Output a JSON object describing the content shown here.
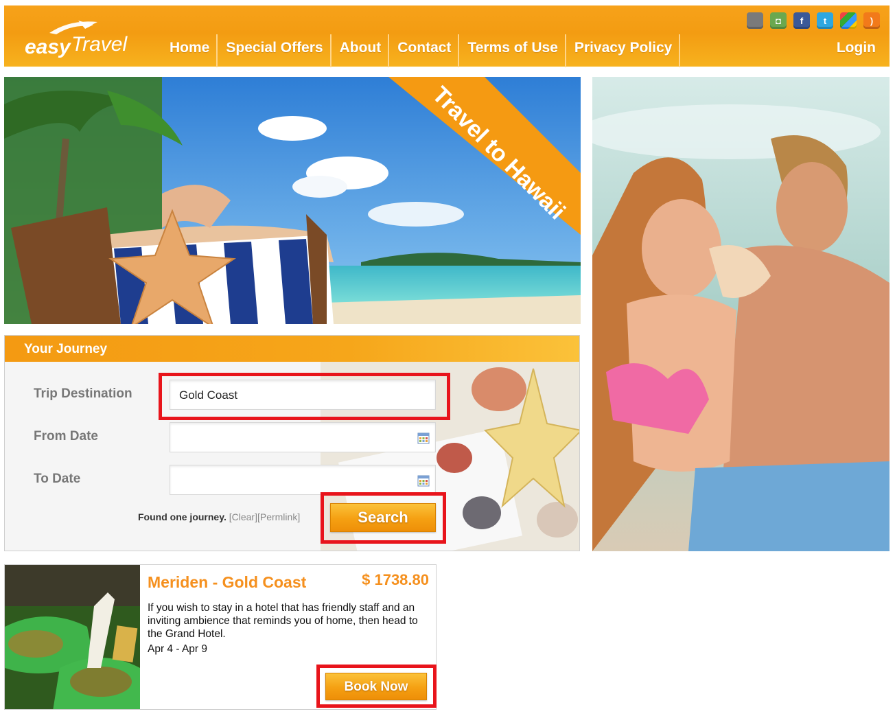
{
  "header": {
    "logo_text": "easyTravel",
    "nav": [
      "Home",
      "Special Offers",
      "About",
      "Contact",
      "Terms of Use",
      "Privacy Policy"
    ],
    "login": "Login",
    "social_icons": [
      "apple-icon",
      "android-icon",
      "facebook-icon",
      "twitter-icon",
      "windows-icon",
      "rss-icon"
    ]
  },
  "hero": {
    "ribbon_text": "Travel to Hawaii"
  },
  "journey": {
    "title": "Your Journey",
    "destination_label": "Trip Destination",
    "destination_value": "Gold Coast",
    "from_label": "From Date",
    "from_value": "",
    "to_label": "To Date",
    "to_value": "",
    "status_text": "Found one journey.",
    "clear_link": "[Clear]",
    "permlink": "[Permlink]",
    "search_button": "Search"
  },
  "result": {
    "title": "Meriden - Gold Coast",
    "price": "$ 1738.80",
    "description": "If you wish to stay in a hotel that has friendly staff and an inviting ambience that reminds you of home, then head to the Grand Hotel.",
    "dates": "Apr 4 - Apr 9",
    "book_button": "Book Now"
  },
  "colors": {
    "brand_orange": "#f39c12",
    "title_orange": "#f5901e",
    "highlight_red": "#e8141b"
  }
}
